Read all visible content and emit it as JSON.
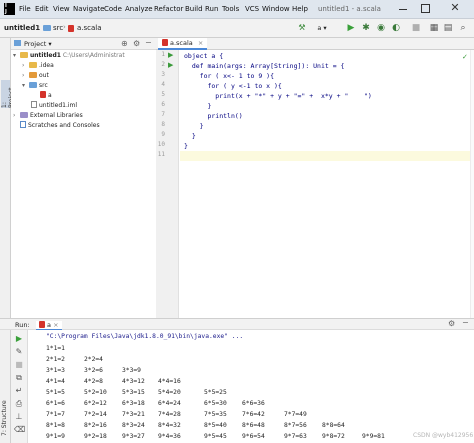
{
  "window": {
    "title": "untitled1 - a.scala",
    "logo_text": [
      "I",
      "J"
    ]
  },
  "menu": [
    "File",
    "Edit",
    "View",
    "Navigate",
    "Code",
    "Analyze",
    "Refactor",
    "Build",
    "Run",
    "Tools",
    "VCS",
    "Window",
    "Help"
  ],
  "breadcrumbs": [
    "untitled1",
    "src",
    "a.scala"
  ],
  "toolbar": {
    "run_config": "a"
  },
  "left_stripe": {
    "project_tab": "1: Project",
    "structure_tab": "7: Structure"
  },
  "project_panel": {
    "header": "Project",
    "tree": [
      {
        "label": "untitled1",
        "extra": "C:\\Users\\Administrat",
        "depth": 0,
        "icon": "folder",
        "expanded": true
      },
      {
        "label": ".idea",
        "depth": 1,
        "icon": "folder",
        "expanded": false
      },
      {
        "label": "out",
        "depth": 1,
        "icon": "folder-orange",
        "expanded": false
      },
      {
        "label": "src",
        "depth": 1,
        "icon": "folder-blue",
        "expanded": true
      },
      {
        "label": "a",
        "depth": 2,
        "icon": "scala-file"
      },
      {
        "label": "untitled1.iml",
        "depth": 1,
        "icon": "file"
      },
      {
        "label": "External Libraries",
        "depth": 0,
        "icon": "library",
        "expanded": false
      },
      {
        "label": "Scratches and Consoles",
        "depth": 0,
        "icon": "scratch"
      }
    ]
  },
  "editor": {
    "tab": "a.scala",
    "lines": [
      "object a {",
      "  def main(args: Array[String]): Unit = {",
      "    for ( x<- 1 to 9 ){",
      "      for ( y <-1 to x ){",
      "        print(x + \"*\" + y + \"=\" +  x*y + \"    \")",
      "      }",
      "      println()",
      "    }",
      "  }",
      "}",
      ""
    ],
    "line_numbers": [
      "1",
      "2",
      "3",
      "4",
      "5",
      "6",
      "7",
      "8",
      "9",
      "10",
      "11"
    ]
  },
  "run_panel": {
    "label": "Run:",
    "config": "a",
    "command": "\"C:\\Program Files\\Java\\jdk1.8.0_91\\bin\\java.exe\" ...",
    "rows": [
      [
        "1*1=1"
      ],
      [
        "2*1=2",
        "2*2=4"
      ],
      [
        "3*1=3",
        "3*2=6",
        "3*3=9"
      ],
      [
        "4*1=4",
        "4*2=8",
        "4*3=12",
        "4*4=16"
      ],
      [
        "5*1=5",
        "5*2=10",
        "5*3=15",
        "5*4=20",
        "5*5=25"
      ],
      [
        "6*1=6",
        "6*2=12",
        "6*3=18",
        "6*4=24",
        "6*5=30",
        "6*6=36"
      ],
      [
        "7*1=7",
        "7*2=14",
        "7*3=21",
        "7*4=28",
        "7*5=35",
        "7*6=42",
        "7*7=49"
      ],
      [
        "8*1=8",
        "8*2=16",
        "8*3=24",
        "8*4=32",
        "8*5=40",
        "8*6=48",
        "8*7=56",
        "8*8=64"
      ],
      [
        "9*1=9",
        "9*2=18",
        "9*3=27",
        "9*4=36",
        "9*5=45",
        "9*6=54",
        "9*7=63",
        "9*8=72",
        "9*9=81"
      ]
    ]
  },
  "watermark": "CSDN @wyb412956"
}
